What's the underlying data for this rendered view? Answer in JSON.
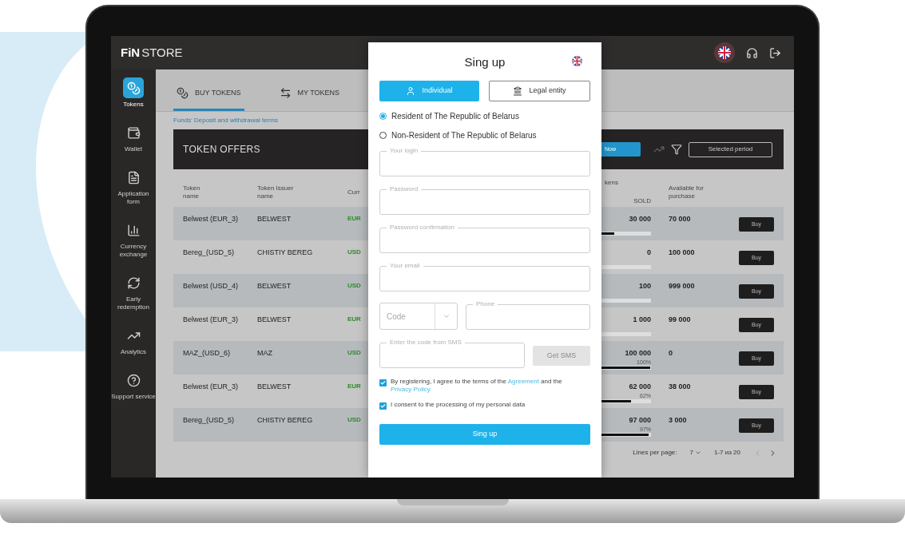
{
  "header": {
    "logo_bold": "FiN",
    "logo_light": "STORE"
  },
  "sidebar": {
    "items": [
      {
        "label": "Tokens",
        "selected": true
      },
      {
        "label": "Wallet",
        "selected": false
      },
      {
        "label": "Application form",
        "selected": false
      },
      {
        "label": "Currency exchange",
        "selected": false
      },
      {
        "label": "Early redemption",
        "selected": false
      },
      {
        "label": "Analytics",
        "selected": false
      },
      {
        "label": "Support service",
        "selected": false
      }
    ]
  },
  "tabs": [
    {
      "label": "BUY TOKENS",
      "selected": true
    },
    {
      "label": "MY TOKENS",
      "selected": false
    }
  ],
  "terms_link": "Funds' Deposit and withdrawal terms",
  "offers": {
    "title": "TOKEN OFFERS",
    "now_button": "Now",
    "period_button": "Selected period"
  },
  "table": {
    "columns": [
      "Token name",
      "Token Issuer name",
      "Curr",
      "kens",
      "SOLD",
      "Available for purchase"
    ],
    "rows": [
      {
        "token": "Belwest (EUR_3)",
        "issuer": "BELWEST",
        "currency": "EUR",
        "sold": "30 000",
        "level": 0.3,
        "available": "70 000",
        "action": "Buy"
      },
      {
        "token": "Bereg_(USD_5)",
        "issuer": "CHISTIY BEREG",
        "currency": "USD",
        "sold": "0",
        "level": 0,
        "available": "100 000",
        "action": "Buy"
      },
      {
        "token": "Belwest (USD_4)",
        "issuer": "BELWEST",
        "currency": "USD",
        "sold": "100",
        "level": 0,
        "available": "999 000",
        "action": "Buy"
      },
      {
        "token": "Belwest (EUR_3)",
        "issuer": "BELWEST",
        "currency": "EUR",
        "sold": "1 000",
        "level": 0.02,
        "available": "99 000",
        "action": "Buy"
      },
      {
        "token": "MAZ_(USD_6)",
        "issuer": "MAZ",
        "currency": "USD",
        "sold": "100 000",
        "percent": "100%",
        "level": 1,
        "available": "0",
        "action": "Buy"
      },
      {
        "token": "Belwest (EUR_3)",
        "issuer": "BELWEST",
        "currency": "EUR",
        "sold": "62 000",
        "percent": "62%",
        "level": 0.62,
        "available": "38 000",
        "action": "Buy"
      },
      {
        "token": "Bereg_(USD_5)",
        "issuer": "CHISTIY BEREG",
        "currency": "USD",
        "sold": "97 000",
        "percent": "97%",
        "level": 0.97,
        "available": "3 000",
        "action": "Buy"
      }
    ]
  },
  "pagination": {
    "lines_label": "Lines per page:",
    "lines_value": "7",
    "range": "1-7 из 20"
  },
  "modal": {
    "title": "Sing up",
    "account_types": [
      {
        "label": "Individual",
        "selected": true
      },
      {
        "label": "Legal entity",
        "selected": false
      }
    ],
    "residency": [
      {
        "label": "Resident of The Republic of Belarus",
        "selected": true
      },
      {
        "label": "Non-Resident of The Republic of Belarus",
        "selected": false
      }
    ],
    "fields": [
      {
        "label": "Your login"
      },
      {
        "label": "Password"
      },
      {
        "label": "Password confirmation"
      },
      {
        "label": "Your email"
      }
    ],
    "code_placeholder": "Code",
    "phone_label": "Phone",
    "sms_label": "Enter the code from SMS",
    "get_sms": {
      "label": "Get SMS",
      "disabled": true
    },
    "agreements": [
      {
        "checked": true,
        "text": "By registering, I agree to the terms of the ",
        "link": "Agreement",
        "text_2": " and the ",
        "link_2": "Privacy Policy"
      },
      {
        "checked": true,
        "text": "I consent to the processing of my personal data"
      }
    ],
    "submit": "Sing up"
  }
}
